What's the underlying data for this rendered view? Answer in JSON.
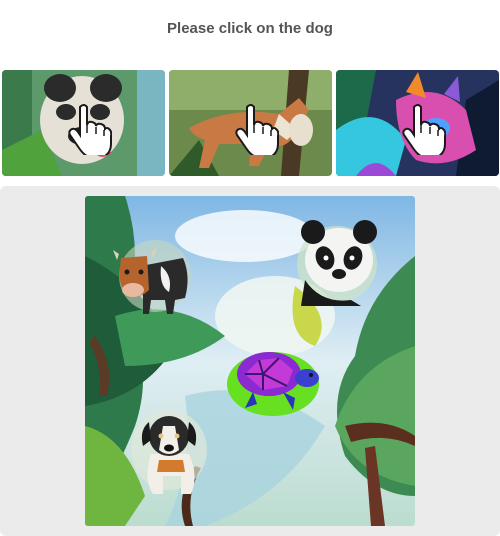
{
  "prompt": {
    "text": "Please click on the dog"
  },
  "examples": [
    {
      "subject": "dog",
      "palette": [
        "#3f8f5a",
        "#e8e2d6",
        "#2a2a2a"
      ]
    },
    {
      "subject": "dog",
      "palette": [
        "#5a7a3a",
        "#c97a44",
        "#e9dfcf"
      ]
    },
    {
      "subject": "dog",
      "palette": [
        "#2c3e7a",
        "#d94fb0",
        "#36c7e0"
      ]
    }
  ],
  "challenge": {
    "animals": [
      "cow",
      "panda",
      "turtle",
      "dog"
    ]
  },
  "icons": {
    "cursor": "pointer-hand-icon"
  },
  "colors": {
    "prompt_text": "#555555",
    "stage_bg": "#ebebeb"
  }
}
